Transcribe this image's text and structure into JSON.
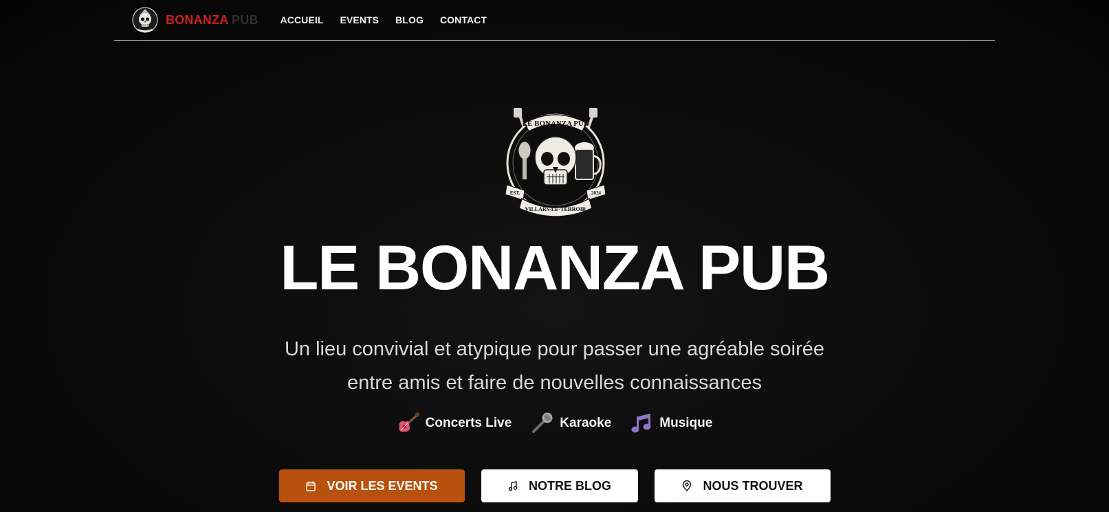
{
  "header": {
    "brand_part1": "BONANZA",
    "brand_part2": " PUB",
    "nav": [
      "ACCUEIL",
      "EVENTS",
      "BLOG",
      "CONTACT"
    ]
  },
  "emblem": {
    "top_banner": "LE BONANZA PUB",
    "left_ribbon": "EST.",
    "right_ribbon": "2024",
    "bottom_banner": "VILLARS-LE-TERROIR"
  },
  "hero": {
    "title": "LE BONANZA PUB",
    "subtitle_line1": "Un lieu convivial et atypique pour passer une agréable soirée",
    "subtitle_line2": "entre amis et faire de nouvelles connaissances"
  },
  "features": [
    {
      "label": "Concerts Live",
      "icon": "guitar-icon"
    },
    {
      "label": "Karaoke",
      "icon": "microphone-icon"
    },
    {
      "label": "Musique",
      "icon": "music-note-icon"
    }
  ],
  "buttons": {
    "events": "VOIR LES EVENTS",
    "blog": "NOTRE BLOG",
    "find": "NOUS TROUVER"
  },
  "colors": {
    "brand_red": "#d01f23",
    "accent_orange": "#b8510d",
    "background": "#050505"
  }
}
